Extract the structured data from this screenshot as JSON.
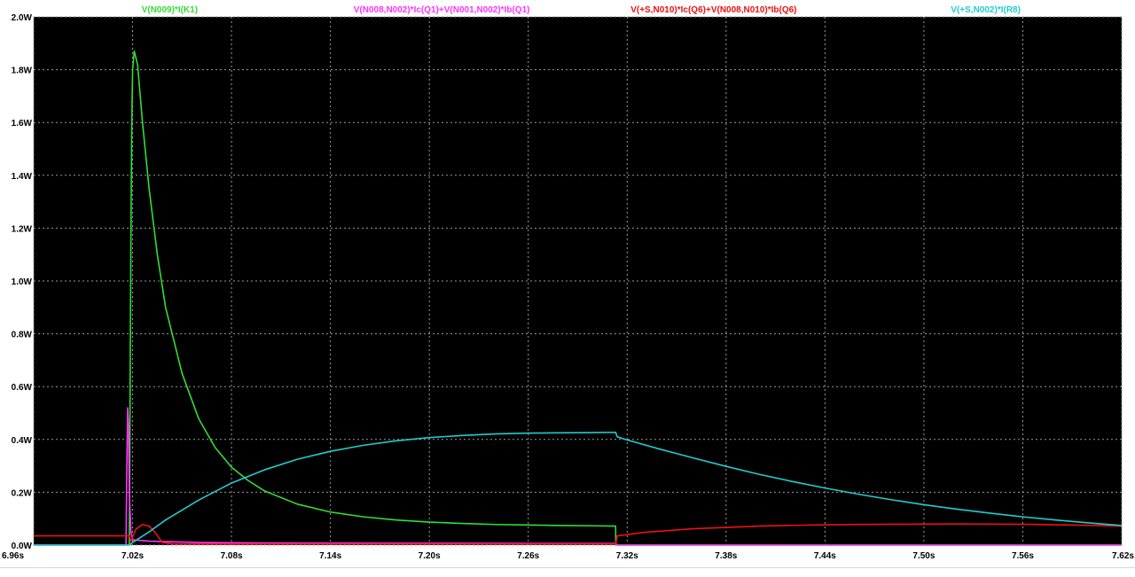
{
  "theme": {
    "frame": "#ffffff",
    "plot_bg": "#000000",
    "grid": "#9a9a9a",
    "tick_text": "#000000"
  },
  "chart_data": {
    "type": "line",
    "title": "",
    "xlabel": "",
    "ylabel": "",
    "xlim": [
      6.96,
      7.62
    ],
    "ylim": [
      0.0,
      2.0
    ],
    "grid": true,
    "legend_position": "top",
    "x_ticks": [
      {
        "value": 6.96,
        "label": "6.96s"
      },
      {
        "value": 7.02,
        "label": "7.02s"
      },
      {
        "value": 7.08,
        "label": "7.08s"
      },
      {
        "value": 7.14,
        "label": "7.14s"
      },
      {
        "value": 7.2,
        "label": "7.20s"
      },
      {
        "value": 7.26,
        "label": "7.26s"
      },
      {
        "value": 7.32,
        "label": "7.32s"
      },
      {
        "value": 7.38,
        "label": "7.38s"
      },
      {
        "value": 7.44,
        "label": "7.44s"
      },
      {
        "value": 7.5,
        "label": "7.50s"
      },
      {
        "value": 7.56,
        "label": "7.56s"
      },
      {
        "value": 7.62,
        "label": "7.62s"
      }
    ],
    "y_ticks": [
      {
        "value": 0.0,
        "label": "0.0W"
      },
      {
        "value": 0.2,
        "label": "0.2W"
      },
      {
        "value": 0.4,
        "label": "0.4W"
      },
      {
        "value": 0.6,
        "label": "0.6W"
      },
      {
        "value": 0.8,
        "label": "0.8W"
      },
      {
        "value": 1.0,
        "label": "1.0W"
      },
      {
        "value": 1.2,
        "label": "1.2W"
      },
      {
        "value": 1.4,
        "label": "1.4W"
      },
      {
        "value": 1.6,
        "label": "1.6W"
      },
      {
        "value": 1.8,
        "label": "1.8W"
      },
      {
        "value": 2.0,
        "label": "2.0W"
      }
    ],
    "series": [
      {
        "name": "V(N009)*I(K1)",
        "color": "#33dd33",
        "points": [
          [
            6.96,
            0.0
          ],
          [
            7.018,
            0.0
          ],
          [
            7.019,
            1.2
          ],
          [
            7.0195,
            1.6
          ],
          [
            7.02,
            1.8
          ],
          [
            7.021,
            1.87
          ],
          [
            7.023,
            1.82
          ],
          [
            7.026,
            1.6
          ],
          [
            7.03,
            1.35
          ],
          [
            7.035,
            1.1
          ],
          [
            7.04,
            0.9
          ],
          [
            7.05,
            0.65
          ],
          [
            7.06,
            0.48
          ],
          [
            7.07,
            0.37
          ],
          [
            7.08,
            0.295
          ],
          [
            7.09,
            0.245
          ],
          [
            7.1,
            0.205
          ],
          [
            7.12,
            0.155
          ],
          [
            7.14,
            0.125
          ],
          [
            7.16,
            0.107
          ],
          [
            7.18,
            0.095
          ],
          [
            7.2,
            0.087
          ],
          [
            7.22,
            0.082
          ],
          [
            7.24,
            0.078
          ],
          [
            7.26,
            0.076
          ],
          [
            7.28,
            0.074
          ],
          [
            7.3,
            0.073
          ],
          [
            7.313,
            0.072
          ],
          [
            7.3131,
            0.0
          ],
          [
            7.62,
            0.0
          ]
        ]
      },
      {
        "name": "V(N008,N002)*Ic(Q1)+V(N001,N002)*Ib(Q1)",
        "color": "#ff33ff",
        "points": [
          [
            6.96,
            0.0
          ],
          [
            7.016,
            0.0
          ],
          [
            7.0165,
            0.3
          ],
          [
            7.017,
            0.52
          ],
          [
            7.0175,
            0.45
          ],
          [
            7.018,
            0.2
          ],
          [
            7.019,
            0.05
          ],
          [
            7.02,
            0.02
          ],
          [
            7.03,
            0.015
          ],
          [
            7.06,
            0.01
          ],
          [
            7.1,
            0.008
          ],
          [
            7.2,
            0.007
          ],
          [
            7.3,
            0.006
          ],
          [
            7.313,
            0.006
          ],
          [
            7.314,
            0.0
          ],
          [
            7.62,
            0.0
          ]
        ]
      },
      {
        "name": "V(+S,N010)*Ic(Q6)+V(N008,N010)*Ib(Q6)",
        "color": "#ee1111",
        "points": [
          [
            6.96,
            0.035
          ],
          [
            7.018,
            0.035
          ],
          [
            7.019,
            0.015
          ],
          [
            7.022,
            0.06
          ],
          [
            7.026,
            0.078
          ],
          [
            7.03,
            0.072
          ],
          [
            7.034,
            0.045
          ],
          [
            7.038,
            0.01
          ],
          [
            7.045,
            0.004
          ],
          [
            7.1,
            0.004
          ],
          [
            7.2,
            0.004
          ],
          [
            7.313,
            0.004
          ],
          [
            7.314,
            0.035
          ],
          [
            7.33,
            0.048
          ],
          [
            7.36,
            0.062
          ],
          [
            7.4,
            0.072
          ],
          [
            7.44,
            0.077
          ],
          [
            7.48,
            0.079
          ],
          [
            7.52,
            0.08
          ],
          [
            7.56,
            0.079
          ],
          [
            7.6,
            0.075
          ],
          [
            7.62,
            0.072
          ]
        ]
      },
      {
        "name": "V(+S,N002)*I(R8)",
        "color": "#22cccc",
        "points": [
          [
            6.96,
            0.0
          ],
          [
            7.018,
            0.0
          ],
          [
            7.02,
            0.01
          ],
          [
            7.03,
            0.05
          ],
          [
            7.04,
            0.095
          ],
          [
            7.06,
            0.17
          ],
          [
            7.08,
            0.235
          ],
          [
            7.1,
            0.285
          ],
          [
            7.12,
            0.325
          ],
          [
            7.14,
            0.355
          ],
          [
            7.16,
            0.378
          ],
          [
            7.18,
            0.395
          ],
          [
            7.2,
            0.407
          ],
          [
            7.22,
            0.415
          ],
          [
            7.24,
            0.421
          ],
          [
            7.26,
            0.424
          ],
          [
            7.28,
            0.425
          ],
          [
            7.3,
            0.426
          ],
          [
            7.313,
            0.427
          ],
          [
            7.314,
            0.41
          ],
          [
            7.32,
            0.398
          ],
          [
            7.34,
            0.363
          ],
          [
            7.36,
            0.33
          ],
          [
            7.38,
            0.298
          ],
          [
            7.4,
            0.268
          ],
          [
            7.42,
            0.241
          ],
          [
            7.44,
            0.216
          ],
          [
            7.46,
            0.193
          ],
          [
            7.48,
            0.172
          ],
          [
            7.5,
            0.153
          ],
          [
            7.52,
            0.136
          ],
          [
            7.54,
            0.121
          ],
          [
            7.56,
            0.107
          ],
          [
            7.58,
            0.095
          ],
          [
            7.6,
            0.084
          ],
          [
            7.62,
            0.074
          ]
        ]
      }
    ]
  }
}
